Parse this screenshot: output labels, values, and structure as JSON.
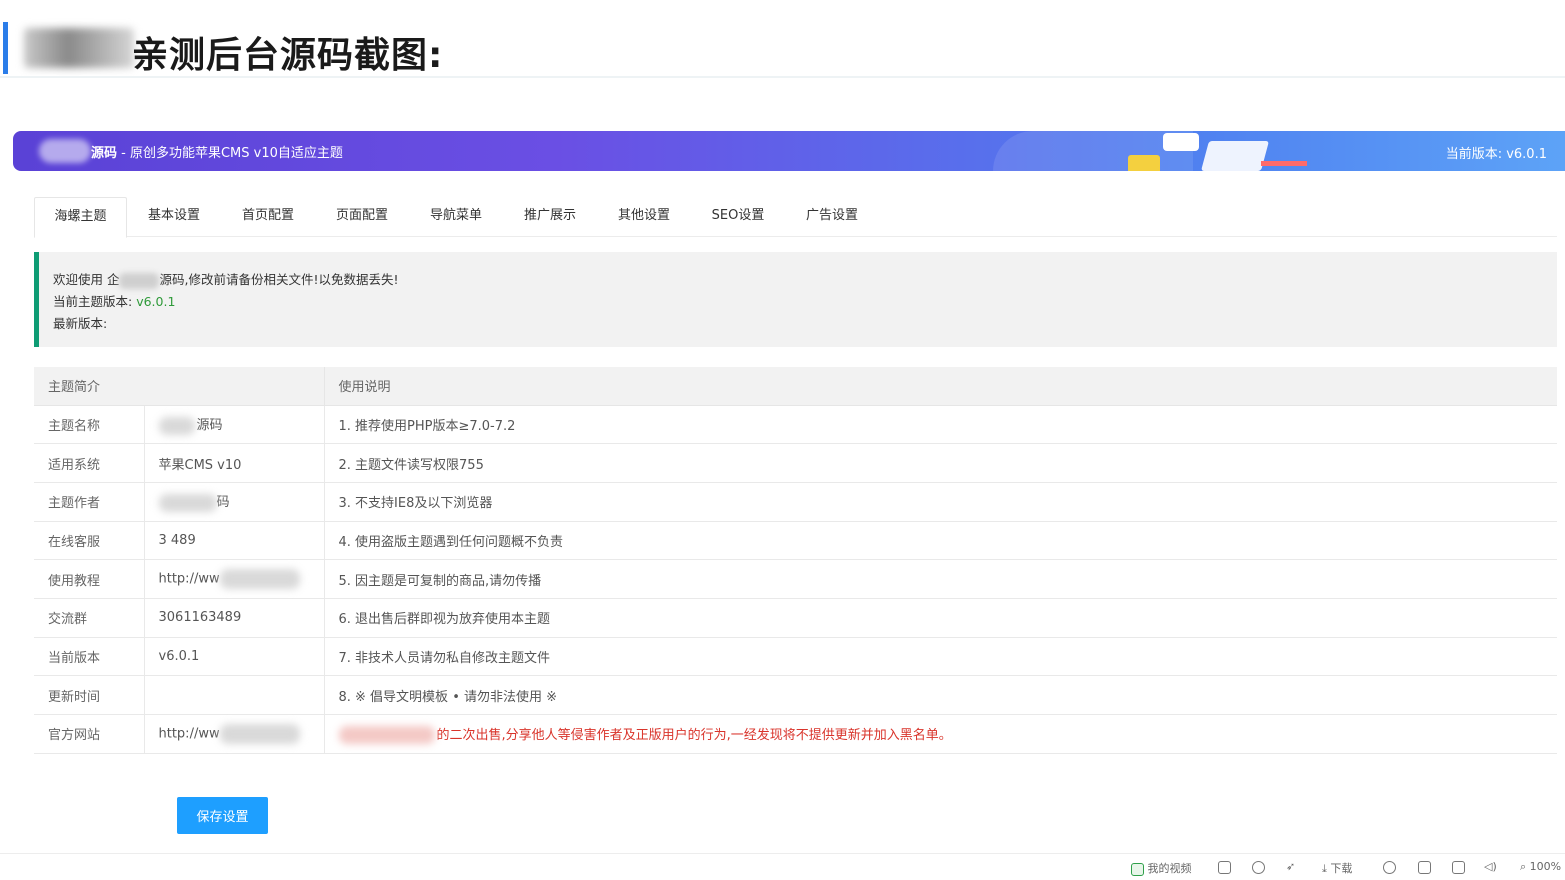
{
  "heading": {
    "text": "亲测后台源码截图:"
  },
  "banner": {
    "brand": "源码",
    "subtitle": " - 原创多功能苹果CMS v10自适应主题",
    "version_label": "当前版本: v6.0.1"
  },
  "tabs": [
    {
      "label": "海螺主题",
      "active": true
    },
    {
      "label": "基本设置",
      "active": false
    },
    {
      "label": "首页配置",
      "active": false
    },
    {
      "label": "页面配置",
      "active": false
    },
    {
      "label": "导航菜单",
      "active": false
    },
    {
      "label": "推广展示",
      "active": false
    },
    {
      "label": "其他设置",
      "active": false
    },
    {
      "label": "SEO设置",
      "active": false
    },
    {
      "label": "广告设置",
      "active": false
    }
  ],
  "notice": {
    "welcome_prefix": "欢迎使用 企",
    "welcome_suffix": "源码,修改前请备份相关文件!以免数据丢失!",
    "current_version_label": "当前主题版本:",
    "current_version_value": "v6.0.1",
    "latest_version_label": "最新版本:"
  },
  "table": {
    "headers": [
      "主题简介",
      "使用说明"
    ],
    "rows": [
      {
        "label": "主题名称",
        "value": "源码",
        "note": "1. 推荐使用PHP版本≥7.0-7.2"
      },
      {
        "label": "适用系统",
        "value": "苹果CMS v10",
        "note": "2. 主题文件读写权限755"
      },
      {
        "label": "主题作者",
        "value": "码",
        "note": "3. 不支持IE8及以下浏览器"
      },
      {
        "label": "在线客服",
        "value": "3 489",
        "note": "4. 使用盗版主题遇到任何问题概不负责"
      },
      {
        "label": "使用教程",
        "value": "http://ww",
        "note": "5. 因主题是可复制的商品,请勿传播"
      },
      {
        "label": "交流群",
        "value": "3061163489",
        "note": "6. 退出售后群即视为放弃使用本主题"
      },
      {
        "label": "当前版本",
        "value": "v6.0.1",
        "note": "7. 非技术人员请勿私自修改主题文件"
      },
      {
        "label": "更新时间",
        "value": "",
        "note": "8. ※ 倡导文明模板 • 请勿非法使用 ※"
      },
      {
        "label": "官方网站",
        "value": "http://ww",
        "note": "的二次出售,分享他人等侵害作者及正版用户的行为,一经发现将不提供更新并加入黑名单。"
      }
    ]
  },
  "save_button": {
    "label": "保存设置"
  },
  "statusbar": {
    "my_video": "我的视频",
    "download": "下载",
    "zoom": "100%"
  },
  "colors": {
    "accent_blue": "#1e9fff",
    "notice_border": "#0e9c74",
    "warning_red": "#d9342b"
  }
}
